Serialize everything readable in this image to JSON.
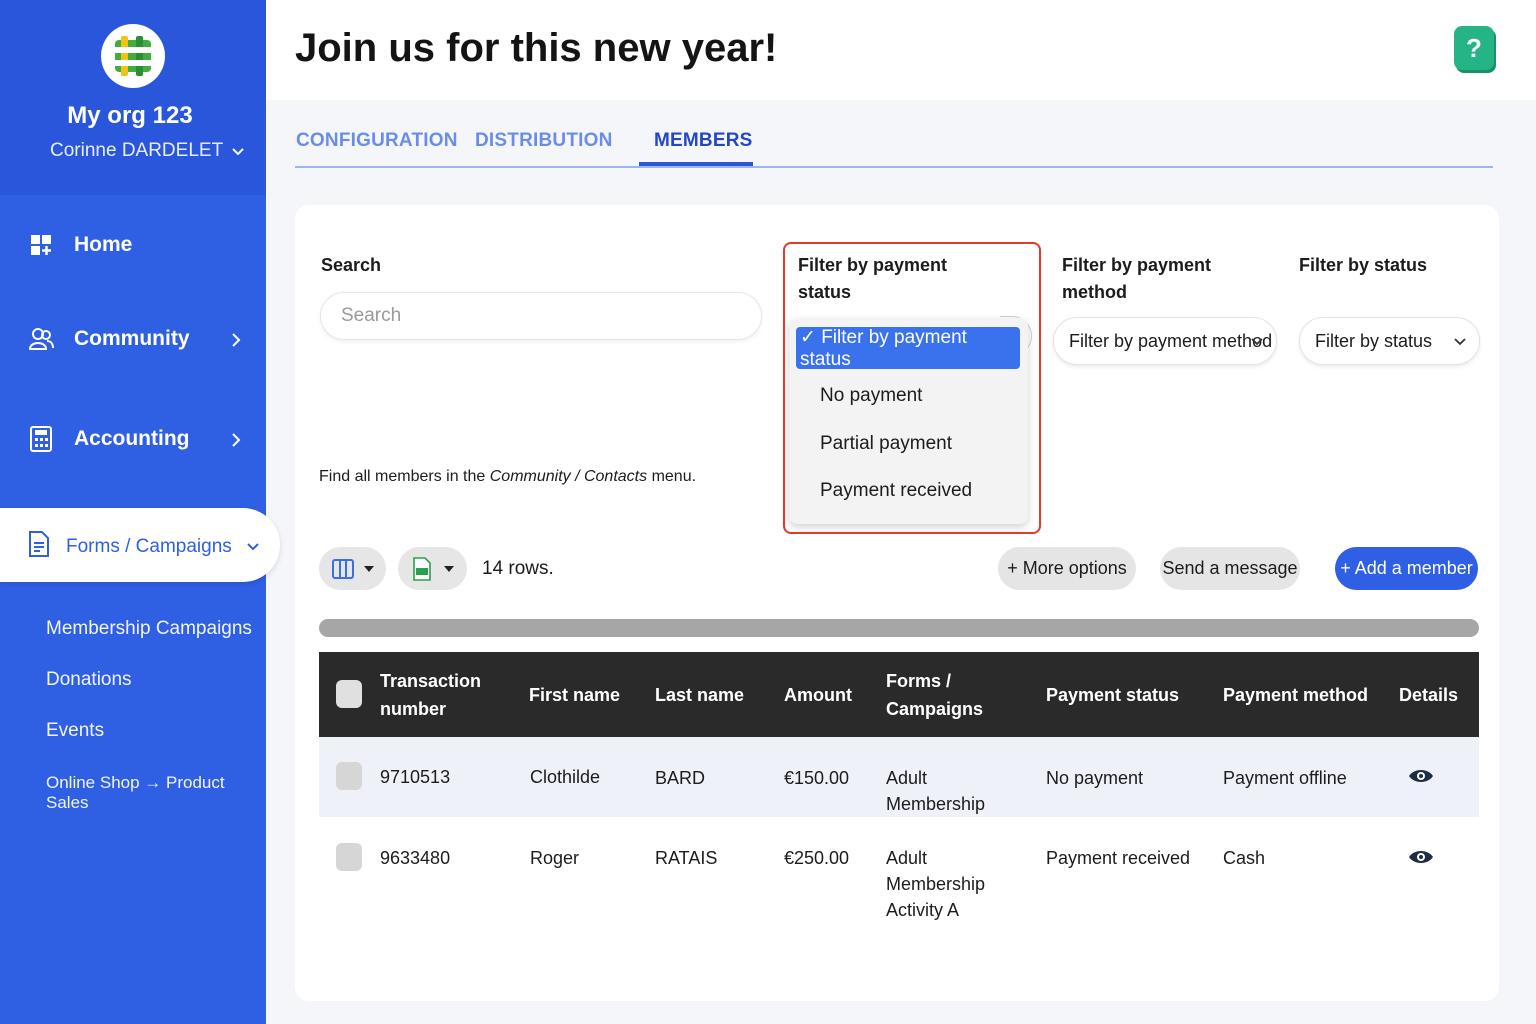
{
  "sidebar": {
    "org_name": "My org 123",
    "user_name": "Corinne DARDELET",
    "nav": [
      {
        "label": "Home",
        "icon": "home-grid-icon"
      },
      {
        "label": "Community",
        "icon": "people-icon"
      },
      {
        "label": "Accounting",
        "icon": "calculator-icon"
      }
    ],
    "active_item": {
      "label": "Forms / Campaigns",
      "icon": "document-icon"
    },
    "sub_items": [
      "Membership Campaigns",
      "Donations",
      "Events",
      "Online Shop → Product Sales"
    ]
  },
  "header": {
    "title": "Join us for this new year!",
    "help_label": "?"
  },
  "tabs": [
    {
      "label": "CONFIGURATION",
      "active": false
    },
    {
      "label": "DISTRIBUTION",
      "active": false
    },
    {
      "label": "MEMBERS",
      "active": true
    }
  ],
  "filters": {
    "search_label": "Search",
    "search_placeholder": "Search",
    "payment_status_label": "Filter by payment status",
    "payment_status_options": [
      {
        "label": "✓ Filter by payment status",
        "selected": true
      },
      {
        "label": "No payment",
        "selected": false
      },
      {
        "label": "Partial payment",
        "selected": false
      },
      {
        "label": "Payment received",
        "selected": false
      }
    ],
    "payment_method_label": "Filter by payment method",
    "payment_method_value": "Filter by payment method",
    "status_label": "Filter by status",
    "status_value": "Filter by status"
  },
  "hint": {
    "prefix": "Find all members in the ",
    "emph": "Community / Contacts",
    "suffix": " menu."
  },
  "toolbar": {
    "rows_count": "14 rows.",
    "more_options": "+ More options",
    "send_message": "Send a message",
    "add_member": "+ Add a member"
  },
  "table": {
    "columns": [
      "Transaction number",
      "First name",
      "Last name",
      "Amount",
      "Forms / Campaigns",
      "Payment status",
      "Payment method",
      "Details"
    ],
    "rows": [
      {
        "transaction": "9710513",
        "first_name": "Clothilde",
        "last_name": "BARD",
        "amount": "€150.00",
        "campaign": "Adult Membership",
        "payment_status": "No payment",
        "payment_method": "Payment offline"
      },
      {
        "transaction": "9633480",
        "first_name": "Roger",
        "last_name": "RATAIS",
        "amount": "€250.00",
        "campaign": "Adult Membership Activity A",
        "payment_status": "Payment received",
        "payment_method": "Cash"
      }
    ]
  },
  "colors": {
    "sidebar": "#2f5fe3",
    "accent": "#2e5fe4",
    "help": "#25b486",
    "highlight": "#e23a2b",
    "table_header": "#2a2a2a"
  }
}
